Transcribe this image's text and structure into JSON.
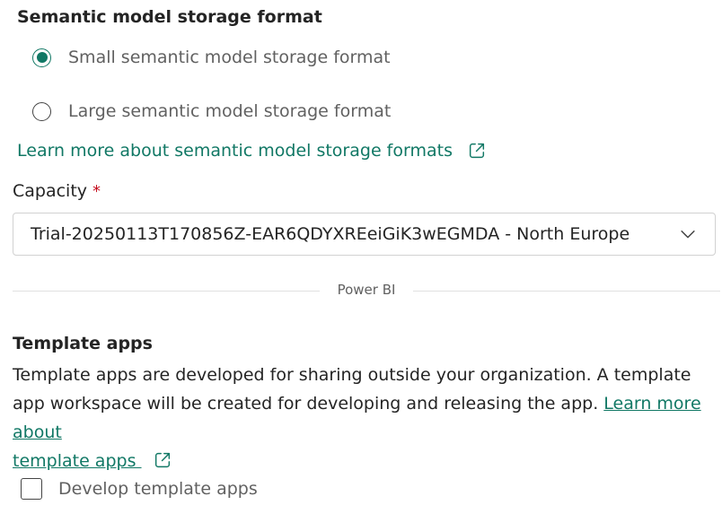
{
  "storage_format": {
    "title": "Semantic model storage format",
    "options": [
      {
        "label": "Small semantic model storage format",
        "selected": true
      },
      {
        "label": "Large semantic model storage format",
        "selected": false
      }
    ],
    "learn_more": "Learn more about semantic model storage formats"
  },
  "capacity": {
    "label": "Capacity",
    "required_marker": "*",
    "value": "Trial-20250113T170856Z-EAR6QDYXREeiGiK3wEGMDA - North Europe"
  },
  "divider": {
    "label": "Power BI"
  },
  "template_apps": {
    "title": "Template apps",
    "description": "Template apps are developed for sharing outside your organization. A template app workspace will be created for developing and releasing the app.",
    "link_text_1": "Learn more about",
    "link_text_2": "template apps",
    "checkbox_label": "Develop template apps",
    "checkbox_checked": false
  },
  "colors": {
    "accent": "#117865",
    "required": "#c50f1f",
    "border": "#d1d1d1",
    "muted_text": "#616161"
  },
  "icons": {
    "external_link": "external-link-icon",
    "dropdown": "chevron-down-icon"
  }
}
